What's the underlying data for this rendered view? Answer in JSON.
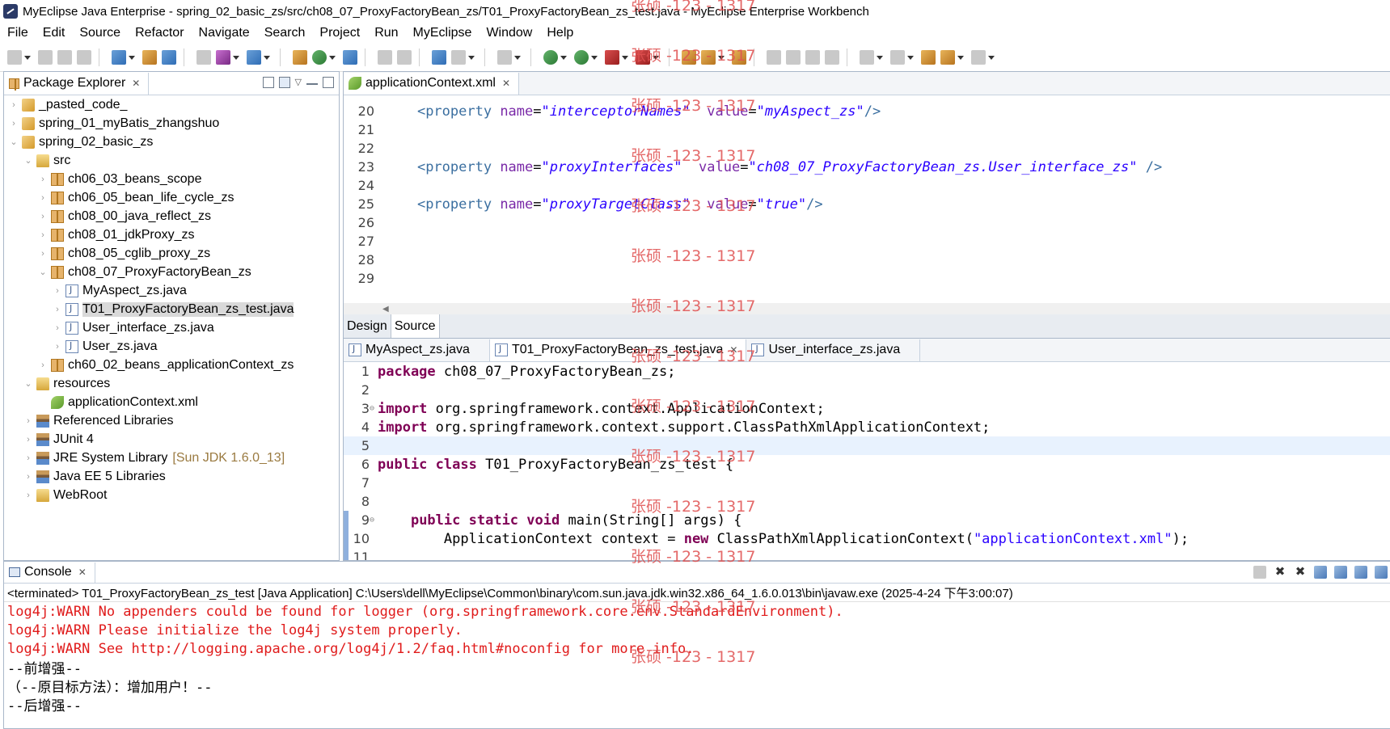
{
  "window": {
    "title": "MyEclipse Java Enterprise - spring_02_basic_zs/src/ch08_07_ProxyFactoryBean_zs/T01_ProxyFactoryBean_zs_test.java - MyEclipse Enterprise Workbench"
  },
  "menu": [
    "File",
    "Edit",
    "Source",
    "Refactor",
    "Navigate",
    "Search",
    "Project",
    "Run",
    "MyEclipse",
    "Window",
    "Help"
  ],
  "explorer": {
    "title": "Package Explorer",
    "tree": [
      {
        "label": "_pasted_code_",
        "icon": "project-icon",
        "indent": 0,
        "twisty": "›"
      },
      {
        "label": "spring_01_myBatis_zhangshuo",
        "icon": "project-icon",
        "indent": 0,
        "twisty": "›"
      },
      {
        "label": "spring_02_basic_zs",
        "icon": "project-icon",
        "indent": 0,
        "twisty": "⌄"
      },
      {
        "label": "src",
        "icon": "folder-icon",
        "indent": 1,
        "twisty": "⌄"
      },
      {
        "label": "ch06_03_beans_scope",
        "icon": "package-icon",
        "indent": 2,
        "twisty": "›"
      },
      {
        "label": "ch06_05_bean_life_cycle_zs",
        "icon": "package-icon",
        "indent": 2,
        "twisty": "›"
      },
      {
        "label": "ch08_00_java_reflect_zs",
        "icon": "package-icon",
        "indent": 2,
        "twisty": "›"
      },
      {
        "label": "ch08_01_jdkProxy_zs",
        "icon": "package-icon",
        "indent": 2,
        "twisty": "›"
      },
      {
        "label": "ch08_05_cglib_proxy_zs",
        "icon": "package-icon",
        "indent": 2,
        "twisty": "›"
      },
      {
        "label": "ch08_07_ProxyFactoryBean_zs",
        "icon": "package-icon",
        "indent": 2,
        "twisty": "⌄"
      },
      {
        "label": "MyAspect_zs.java",
        "icon": "java-file-icon",
        "indent": 3,
        "twisty": "›"
      },
      {
        "label": "T01_ProxyFactoryBean_zs_test.java",
        "icon": "java-file-icon",
        "indent": 3,
        "twisty": "›",
        "selected": true
      },
      {
        "label": "User_interface_zs.java",
        "icon": "java-file-icon",
        "indent": 3,
        "twisty": "›"
      },
      {
        "label": "User_zs.java",
        "icon": "java-file-icon",
        "indent": 3,
        "twisty": "›"
      },
      {
        "label": "ch60_02_beans_applicationContext_zs",
        "icon": "package-icon",
        "indent": 2,
        "twisty": "›"
      },
      {
        "label": "resources",
        "icon": "folder-icon",
        "indent": 1,
        "twisty": "⌄"
      },
      {
        "label": "applicationContext.xml",
        "icon": "xml-file-icon",
        "indent": 2,
        "twisty": ""
      },
      {
        "label": "Referenced Libraries",
        "icon": "library-icon",
        "indent": 1,
        "twisty": "›"
      },
      {
        "label": "JUnit 4",
        "icon": "library-icon",
        "indent": 1,
        "twisty": "›"
      },
      {
        "label": "JRE System Library",
        "icon": "library-icon",
        "indent": 1,
        "twisty": "›",
        "extra": "[Sun JDK 1.6.0_13]"
      },
      {
        "label": "Java EE 5 Libraries",
        "icon": "library-icon",
        "indent": 1,
        "twisty": "›"
      },
      {
        "label": "WebRoot",
        "icon": "folder-icon",
        "indent": 1,
        "twisty": "›"
      }
    ]
  },
  "xml_editor": {
    "tab": "applicationContext.xml",
    "lines": [
      {
        "n": "20",
        "tag": "<property ",
        "a1": "name",
        "v1": "\"interceptorNames\"",
        "gap": "  ",
        "a2": "value",
        "v2": "\"myAspect_zs\"",
        "end": "/>"
      },
      {
        "n": "21"
      },
      {
        "n": "22"
      },
      {
        "n": "23",
        "tag": "<property ",
        "a1": "name",
        "v1": "\"proxyInterfaces\"",
        "gap": "  ",
        "a2": "value",
        "v2": "\"ch08_07_ProxyFactoryBean_zs.User_interface_zs\"",
        "end": " />"
      },
      {
        "n": "24"
      },
      {
        "n": "25",
        "tag": "<property ",
        "a1": "name",
        "v1": "\"proxyTargetClass\"",
        "gap": "  ",
        "a2": "value",
        "v2": "\"true\"",
        "end": "/>"
      },
      {
        "n": "26"
      },
      {
        "n": "27"
      },
      {
        "n": "28"
      },
      {
        "n": "29"
      }
    ],
    "bottom_tabs": [
      "Design",
      "Source"
    ]
  },
  "java_editor": {
    "tabs": [
      {
        "label": "MyAspect_zs.java",
        "active": false
      },
      {
        "label": "T01_ProxyFactoryBean_zs_test.java",
        "active": true
      },
      {
        "label": "User_interface_zs.java",
        "active": false
      }
    ],
    "lines": [
      {
        "n": "1",
        "code": "package ch08_07_ProxyFactoryBean_zs;"
      },
      {
        "n": "2",
        "code": ""
      },
      {
        "n": "3",
        "code": "import org.springframework.context.ApplicationContext;"
      },
      {
        "n": "4",
        "code": "import org.springframework.context.support.ClassPathXmlApplicationContext;"
      },
      {
        "n": "5",
        "code": ""
      },
      {
        "n": "6",
        "code": "public class T01_ProxyFactoryBean_zs_test {"
      },
      {
        "n": "7",
        "code": ""
      },
      {
        "n": "8",
        "code": ""
      },
      {
        "n": "9",
        "code": "    public static void main(String[] args) {"
      },
      {
        "n": "10",
        "code": "        ApplicationContext context = new ClassPathXmlApplicationContext(\"applicationContext.xml\");"
      },
      {
        "n": "11",
        "code": ""
      }
    ]
  },
  "console": {
    "title": "Console",
    "status": "<terminated> T01_ProxyFactoryBean_zs_test [Java Application] C:\\Users\\dell\\MyEclipse\\Common\\binary\\com.sun.java.jdk.win32.x86_64_1.6.0.013\\bin\\javaw.exe (2025-4-24 下午3:00:07)",
    "lines": [
      {
        "text": "log4j:WARN No appenders could be found for logger (org.springframework.core.env.StandardEnvironment).",
        "type": "err"
      },
      {
        "text": "log4j:WARN Please initialize the log4j system properly.",
        "type": "err"
      },
      {
        "text": "log4j:WARN See http://logging.apache.org/log4j/1.2/faq.html#noconfig for more info.",
        "type": "err"
      },
      {
        "text": "--前增强--",
        "type": "out"
      },
      {
        "text": "（--原目标方法）：增加用户！--",
        "type": "out"
      },
      {
        "text": "--后增强--",
        "type": "out"
      }
    ]
  },
  "watermark": "张硕 -123 - 1317",
  "colors": {
    "console_error": "#e01b1b",
    "xml_value": "#2a00ff",
    "keyword": "#7f0055",
    "watermark": "#e05050"
  }
}
